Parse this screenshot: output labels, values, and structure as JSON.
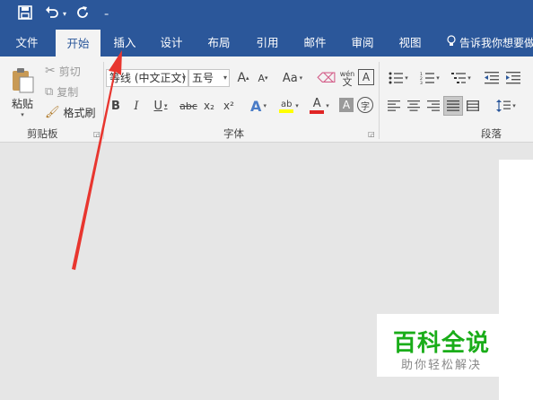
{
  "quick_access": {
    "save_icon": "save-icon",
    "undo_icon": "undo-icon",
    "redo_icon": "redo-icon",
    "customize_icon": "customize-icon"
  },
  "tabs": [
    {
      "label": "文件"
    },
    {
      "label": "开始"
    },
    {
      "label": "插入"
    },
    {
      "label": "设计"
    },
    {
      "label": "布局"
    },
    {
      "label": "引用"
    },
    {
      "label": "邮件"
    },
    {
      "label": "审阅"
    },
    {
      "label": "视图"
    }
  ],
  "tell_me": "告诉我你想要做",
  "clipboard": {
    "paste": "粘贴",
    "cut": "剪切",
    "copy": "复制",
    "format_painter": "格式刷",
    "group_label": "剪贴板"
  },
  "font": {
    "font_name": "等线 (中文正文)",
    "font_size": "五号",
    "grow": "A",
    "shrink": "A",
    "change_case": "Aa",
    "phonetic": "wén",
    "bold": "B",
    "italic": "I",
    "underline": "U",
    "strike": "abc",
    "subscript": "x₂",
    "superscript": "x²",
    "group_label": "字体"
  },
  "paragraph": {
    "group_label": "段落"
  },
  "watermark": {
    "title": "百科全说",
    "subtitle": "助你轻松解决"
  },
  "colors": {
    "title_bar": "#2b579a",
    "ribbon_bg": "#f3f3f3",
    "doc_bg": "#e6e6e6",
    "arrow": "#e8362f",
    "watermark_green": "#1aad19"
  }
}
